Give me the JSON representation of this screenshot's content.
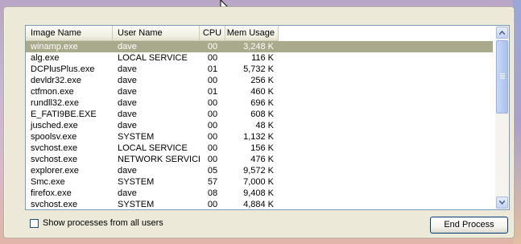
{
  "columns": [
    {
      "key": "image",
      "label": "Image Name"
    },
    {
      "key": "user",
      "label": "User Name"
    },
    {
      "key": "cpu",
      "label": "CPU"
    },
    {
      "key": "mem",
      "label": "Mem Usage"
    }
  ],
  "processes": [
    {
      "image": "winamp.exe",
      "user": "dave",
      "cpu": "00",
      "mem": "3,248 K",
      "selected": true
    },
    {
      "image": "alg.exe",
      "user": "LOCAL SERVICE",
      "cpu": "00",
      "mem": "116 K"
    },
    {
      "image": "DCPlusPlus.exe",
      "user": "dave",
      "cpu": "01",
      "mem": "5,732 K"
    },
    {
      "image": "devldr32.exe",
      "user": "dave",
      "cpu": "00",
      "mem": "256 K"
    },
    {
      "image": "ctfmon.exe",
      "user": "dave",
      "cpu": "01",
      "mem": "460 K"
    },
    {
      "image": "rundll32.exe",
      "user": "dave",
      "cpu": "00",
      "mem": "696 K"
    },
    {
      "image": "E_FATI9BE.EXE",
      "user": "dave",
      "cpu": "00",
      "mem": "608 K"
    },
    {
      "image": "jusched.exe",
      "user": "dave",
      "cpu": "00",
      "mem": "48 K"
    },
    {
      "image": "spoolsv.exe",
      "user": "SYSTEM",
      "cpu": "00",
      "mem": "1,132 K"
    },
    {
      "image": "svchost.exe",
      "user": "LOCAL SERVICE",
      "cpu": "00",
      "mem": "156 K"
    },
    {
      "image": "svchost.exe",
      "user": "NETWORK SERVICE",
      "cpu": "00",
      "mem": "476 K"
    },
    {
      "image": "explorer.exe",
      "user": "dave",
      "cpu": "05",
      "mem": "9,572 K"
    },
    {
      "image": "Smc.exe",
      "user": "SYSTEM",
      "cpu": "57",
      "mem": "7,000 K"
    },
    {
      "image": "firefox.exe",
      "user": "dave",
      "cpu": "08",
      "mem": "9,408 K"
    },
    {
      "image": "svchost.exe",
      "user": "SYSTEM",
      "cpu": "00",
      "mem": "4,884 K"
    }
  ],
  "show_all_label": "Show processes from all users",
  "end_process_label": "End Process",
  "colors": {
    "selected_row": "#a9a98c",
    "panel": "#ece9d8",
    "list_border": "#7f9db9"
  }
}
